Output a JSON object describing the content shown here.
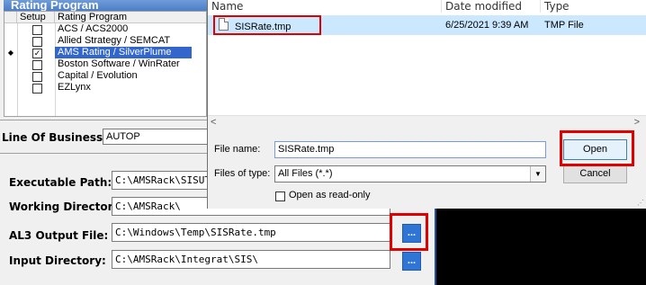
{
  "rating_program": {
    "header": "Rating Program",
    "col_setup": "Setup",
    "col_name": "Rating Program",
    "rows": [
      {
        "name": "ACS / ACS2000",
        "checked": false,
        "current": false,
        "selected": false
      },
      {
        "name": "Allied Strategy / SEMCAT",
        "checked": false,
        "current": false,
        "selected": false
      },
      {
        "name": "AMS Rating / SilverPlume",
        "checked": true,
        "current": true,
        "selected": true
      },
      {
        "name": "Boston Software / WinRater",
        "checked": false,
        "current": false,
        "selected": false
      },
      {
        "name": "Capital / Evolution",
        "checked": false,
        "current": false,
        "selected": false
      },
      {
        "name": "EZLynx",
        "checked": false,
        "current": false,
        "selected": false
      }
    ],
    "current_marker": "◆",
    "check_mark": "✓"
  },
  "line_of_business": {
    "label": "Line Of Business:",
    "value": "AUTOP"
  },
  "fields": {
    "exec_path": {
      "label": "Executable Path:",
      "value": "C:\\AMSRack\\SISUTIL."
    },
    "working_dir": {
      "label": "Working Directory:",
      "value": "C:\\AMSRack\\"
    },
    "al3_output": {
      "label": "AL3 Output File:",
      "value": "C:\\Windows\\Temp\\SISRate.tmp"
    },
    "input_dir": {
      "label": "Input Directory:",
      "value": "C:\\AMSRack\\Integrat\\SIS\\"
    },
    "browse_label": "..."
  },
  "dialog": {
    "columns": {
      "name": "Name",
      "date": "Date modified",
      "type": "Type"
    },
    "files": [
      {
        "name": "SISRate.tmp",
        "date": "6/25/2021 9:39 AM",
        "type": "TMP File"
      }
    ],
    "scroll_left": "<",
    "scroll_right": ">",
    "file_name_label": "File name:",
    "file_name_value": "SISRate.tmp",
    "file_type_label": "Files of type:",
    "file_type_value": "All Files (*.*)",
    "read_only_label": "Open as read-only",
    "open_label": "Open",
    "cancel_label": "Cancel",
    "dropdown_arrow": "▼",
    "grip": "⋰"
  },
  "colors": {
    "highlight": "#e00000",
    "selection": "#3366cc",
    "file_row": "#cce8ff",
    "browse": "#2f75d6"
  }
}
